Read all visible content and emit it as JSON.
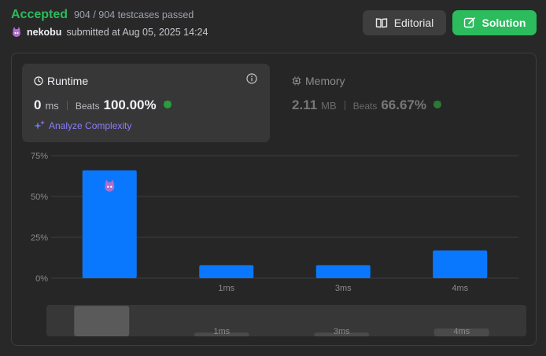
{
  "header": {
    "status": "Accepted",
    "testcases": "904 / 904 testcases passed",
    "username": "nekobu",
    "submitted_text": "submitted at Aug 05, 2025 14:24",
    "editorial_label": "Editorial",
    "solution_label": "Solution"
  },
  "runtime": {
    "title": "Runtime",
    "value": "0",
    "unit": "ms",
    "beats_label": "Beats",
    "beats_value": "100.00%",
    "analyze_label": "Analyze Complexity"
  },
  "memory": {
    "title": "Memory",
    "value": "2.11",
    "unit": "MB",
    "beats_label": "Beats",
    "beats_value": "66.67%"
  },
  "colors": {
    "accent_green": "#2cbb5d",
    "bar_blue": "#0a78fe",
    "analyze_purple": "#8a7dfa"
  },
  "chart_data": {
    "type": "bar",
    "categories": [
      "",
      "1ms",
      "3ms",
      "4ms"
    ],
    "values": [
      66,
      8,
      8,
      17
    ],
    "ylim": [
      0,
      75
    ],
    "yticks": [
      "0%",
      "25%",
      "50%",
      "75%"
    ],
    "ytick_values": [
      0,
      25,
      50,
      75
    ],
    "highlight_index": 0,
    "grid": true
  }
}
